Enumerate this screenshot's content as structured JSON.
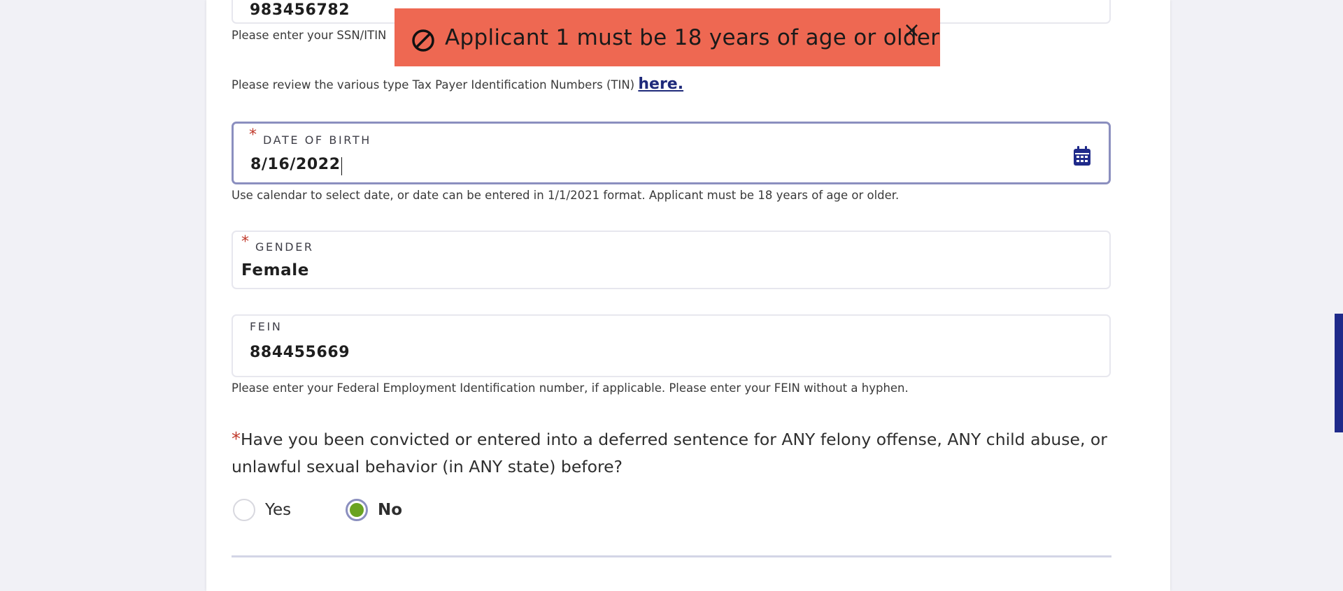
{
  "ssn": {
    "value": "983456782",
    "help": "Please enter your SSN/ITIN"
  },
  "tin_note": {
    "text": "Please review the various type Tax Payer Identification Numbers (TIN) ",
    "link": "here."
  },
  "dob": {
    "label": "DATE OF BIRTH",
    "required": "*",
    "value": "8/16/2022",
    "help": "Use calendar to select date, or date can be entered in 1/1/2021 format. Applicant must be 18 years of age or older.",
    "icon": "calendar-icon"
  },
  "gender": {
    "label": "GENDER",
    "required": "*",
    "value": "Female"
  },
  "fein": {
    "label": "FEIN",
    "value": "884455669",
    "help": "Please enter your Federal Employment Identification number, if applicable. Please enter your FEIN without a hyphen."
  },
  "felony_question": {
    "required": "*",
    "text": "Have you been convicted or entered into a deferred sentence for ANY felony offense, ANY child abuse, or unlawful sexual behavior (in ANY state) before?",
    "options": [
      {
        "label": "Yes",
        "checked": false
      },
      {
        "label": "No",
        "checked": true
      }
    ]
  },
  "toast": {
    "message": "Applicant 1 must be 18 years of age or older",
    "close": "×",
    "icon": "ban-icon",
    "color": "#ee6852"
  },
  "colors": {
    "accent": "#1f2a8a",
    "radio_checked": "#6aa321",
    "required": "#c0392b"
  }
}
